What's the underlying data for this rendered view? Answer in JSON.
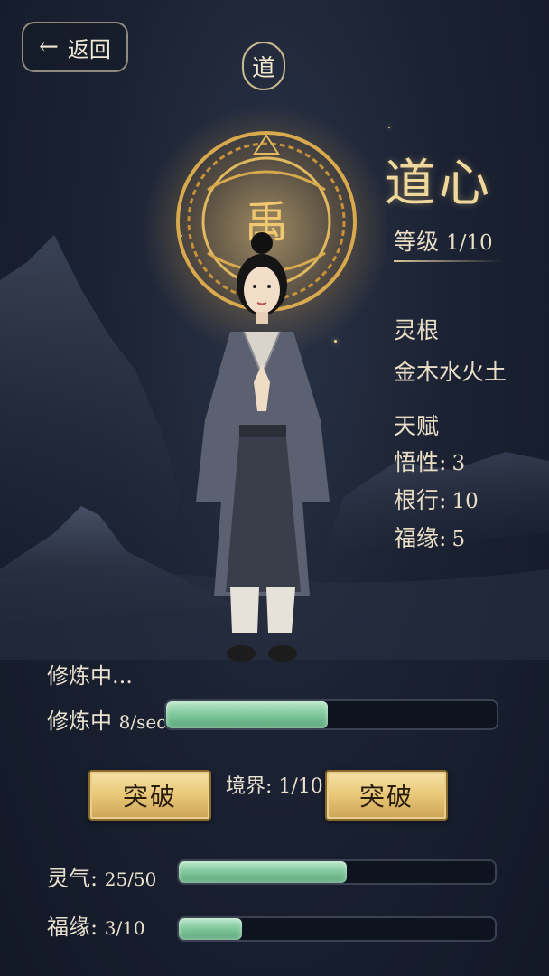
{
  "header": {
    "back_label": "返回",
    "emblem_char": "道"
  },
  "character": {
    "title": "道心",
    "level_label": "等级",
    "level_value": "1/10",
    "halo_char": "禹"
  },
  "stats": {
    "root_label": "灵根",
    "root_value": "金木水火土",
    "talent_label": "天赋",
    "items": [
      {
        "label": "悟性:",
        "value": "3"
      },
      {
        "label": "根行:",
        "value": "10"
      },
      {
        "label": "福缘:",
        "value": "5"
      }
    ]
  },
  "cultivation": {
    "status_text": "修炼中...",
    "rate_label": "修炼中",
    "rate_value": "8/sec",
    "rate_progress": 0.49
  },
  "breakthrough": {
    "left_button": "突破",
    "right_button": "突破",
    "realm_text": "境界: 1/10"
  },
  "resources": {
    "qi_label": "灵气:",
    "qi_value": "25/50",
    "qi_progress": 0.53,
    "fortune_label": "福缘:",
    "fortune_value": "3/10",
    "fortune_progress": 0.2
  },
  "colors": {
    "accent_gold": "#f0d79c",
    "bar_fill": "#7fc79b",
    "background": "#1b2233"
  },
  "icons": {
    "back": "arrow-left-icon",
    "emblem": "dao-emblem-icon",
    "halo": "golden-halo-icon"
  }
}
